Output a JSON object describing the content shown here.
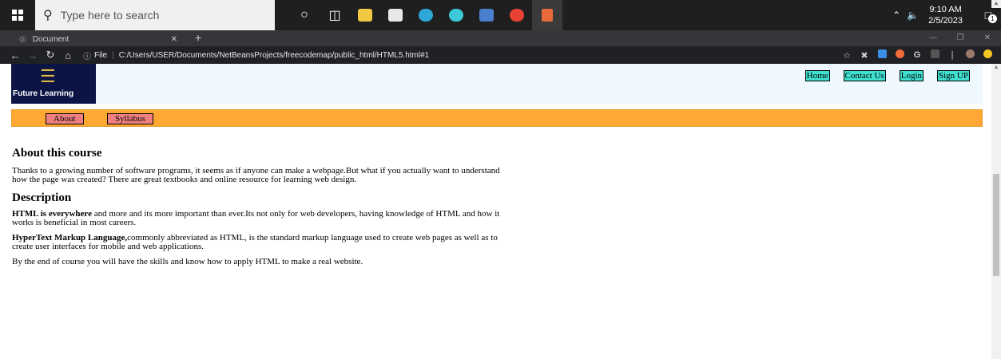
{
  "taskbar": {
    "search_placeholder": "Type here to search",
    "icons": [
      "cortana-icon",
      "task-view-icon",
      "file-explorer-icon",
      "store-icon",
      "edge-icon",
      "app-icon",
      "photos-icon",
      "chrome-icon",
      "netbeans-icon"
    ],
    "time": "9:10 AM",
    "date": "2/5/2023",
    "notification_count": "1"
  },
  "browser": {
    "tab_title": "Document",
    "address_prefix": "File",
    "url": "C:/Users/USER/Documents/NetBeansProjects/freecodemap/public_html/HTML5.html#1"
  },
  "page": {
    "logo_text": "Future Learning",
    "top_nav": [
      "Home",
      "Contact Us",
      "Login",
      "Sign UP"
    ],
    "sub_nav": [
      "About",
      "Syllabus"
    ],
    "about_heading": "About this course",
    "about_text": "Thanks to a growing number of software programs, it seems as if anyone can make a webpage.But what if you actually want to understand how the page was created? There are great textbooks and online resource for learning web design.",
    "description_heading": "Description",
    "p1_bold": "HTML is everywhere",
    "p1_rest": " and more and its more important than ever.Its not only for web developers, having knowledge of HTML and how it works is beneficial in most careers.",
    "p2_bold": "HyperText Markup Language,",
    "p2_rest": "commonly abbreviated as HTML, is the standard markup language used to create web pages as well as to create user interfaces for mobile and web applications.",
    "p3": "By the end of course you will have the skills and know how to apply HTML to make a real website."
  },
  "colors": {
    "taskbar": "#1f1f1f",
    "header_bg": "#f0f8ff",
    "logo_bg": "#0c1445",
    "top_nav_bg": "#40e0d0",
    "sub_nav_bar": "#ffa833",
    "sub_nav_button": "#f08080"
  }
}
